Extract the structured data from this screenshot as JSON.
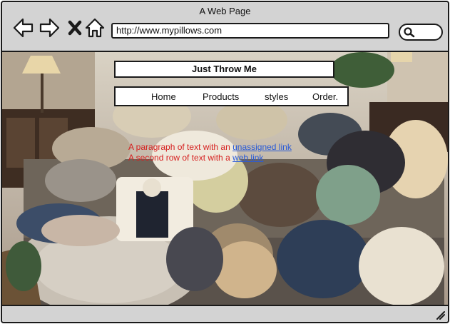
{
  "window": {
    "title": "A Web Page"
  },
  "browser": {
    "url": "http://www.mypillows.com",
    "nav_icons": [
      "back-arrow-icon",
      "forward-arrow-icon",
      "close-x-icon",
      "home-icon"
    ],
    "search_icon": "search-icon"
  },
  "site": {
    "title": "Just Throw Me",
    "nav": [
      "Home",
      "Products",
      "styles",
      "Order."
    ]
  },
  "paragraphs": [
    {
      "text": "A paragraph of text with an ",
      "link": "unassigned link"
    },
    {
      "text": "A second row of text with a ",
      "link": "web link"
    }
  ],
  "colors": {
    "frame": "#1a1a1a",
    "chrome": "#d3d3d3",
    "paragraph_text": "#d62020",
    "link": "#2a5bd7"
  }
}
